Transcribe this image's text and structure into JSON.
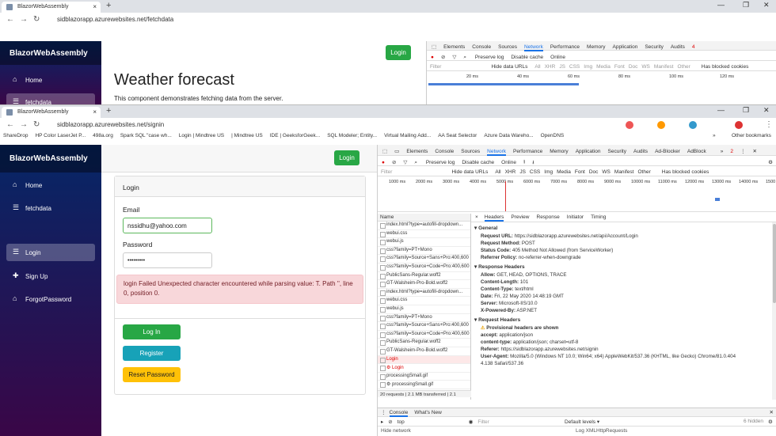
{
  "back": {
    "tab_title": "BlazorWebAssembly",
    "url": "sidblazorapp.azurewebsites.net/fetchdata",
    "brand": "BlazorWebAssembly",
    "nav": [
      "Home",
      "fetchdata"
    ],
    "login_label": "Login",
    "heading": "Weather forecast",
    "subtext": "This component demonstrates fetching data from the server.",
    "dev_tabs": [
      "Elements",
      "Console",
      "Sources",
      "Network",
      "Performance",
      "Memory",
      "Application",
      "Security",
      "Audits"
    ],
    "dev_active": "Network",
    "error_count": "4",
    "filter_placeholder": "Filter",
    "throttle": "Online",
    "preserve_log": "Preserve log",
    "disable_cache": "Disable cache",
    "hide_data_urls": "Hide data URLs",
    "types": [
      "All",
      "XHR",
      "JS",
      "CSS",
      "Img",
      "Media",
      "Font",
      "Doc",
      "WS",
      "Manifest",
      "Other"
    ],
    "blocked": "Has blocked cookies",
    "ticks": [
      "20 ms",
      "40 ms",
      "60 ms",
      "80 ms",
      "100 ms",
      "120 ms"
    ]
  },
  "front": {
    "tab_title": "BlazorWebAssembly",
    "url": "sidblazorapp.azurewebsites.net/signin",
    "bookmarks": [
      "ShareDrop",
      "HP Color LaserJet P...",
      "498a.org",
      "Spark SQL \"case wh...",
      "Login | Mindtree US",
      "| Mindtree US",
      "IDE | GeeksforGeek...",
      "SQL Modeler; Entity...",
      "Virtual Mailing Add...",
      "AA Seat Selector",
      "Azure Data Wareho...",
      "OpenDNS"
    ],
    "other_bookmarks": "Other bookmarks",
    "more_bookmarks": "»",
    "brand": "BlazorWebAssembly",
    "nav": [
      "Home",
      "fetchdata",
      "Login",
      "Sign Up",
      "ForgotPassword"
    ],
    "login_button": "Login",
    "card_title": "Login",
    "email_label": "Email",
    "email_value": "nssidhu@yahoo.com",
    "password_label": "Password",
    "password_value": "•••••••••",
    "alert": "login Failed Unexpected character encountered while parsing value: T. Path '', line 0, position 0.",
    "btn_login": "Log In",
    "btn_register": "Register",
    "btn_reset": "Reset Password",
    "dev_tabs": [
      "Elements",
      "Console",
      "Sources",
      "Network",
      "Performance",
      "Memory",
      "Application",
      "Security",
      "Audits",
      "Ad-Blocker",
      "AdBlock"
    ],
    "dev_active": "Network",
    "error_count": "2",
    "more_tabs": "»",
    "filter_placeholder": "Filter",
    "throttle": "Online",
    "preserve_log": "Preserve log",
    "disable_cache": "Disable cache",
    "hide_data_urls": "Hide data URLs",
    "types": [
      "All",
      "XHR",
      "JS",
      "CSS",
      "Img",
      "Media",
      "Font",
      "Doc",
      "WS",
      "Manifest",
      "Other"
    ],
    "blocked": "Has blocked cookies",
    "ticks": [
      "1000 ms",
      "2000 ms",
      "3000 ms",
      "4000 ms",
      "5000 ms",
      "6000 ms",
      "7000 ms",
      "8000 ms",
      "9000 ms",
      "10000 ms",
      "11000 ms",
      "12000 ms",
      "13000 ms",
      "14000 ms",
      "1500"
    ],
    "name_header": "Name",
    "requests": [
      "index.html?type=autofill-dropdown...",
      "webui.css",
      "webui.js",
      "css?family=PT+Mono",
      "css?family=Source+Sans+Pro:400,600",
      "css?family=Source+Code+Pro:400,600",
      "PublicSans-Regular.woff2",
      "GT-Walsheim-Pro-Bold.woff2",
      "index.html?type=autofill-dropdown...",
      "webui.css",
      "webui.js",
      "css?family=PT+Mono",
      "css?family=Source+Sans+Pro:400,600",
      "css?family=Source+Code+Pro:400,600",
      "PublicSans-Regular.woff2",
      "GT-Walsheim-Pro-Bold.woff2",
      "Login",
      "⚙ Login",
      "processingSmall.gif",
      "⚙ processingSmall.gif"
    ],
    "error_requests": [
      16,
      17
    ],
    "summary": "20 requests | 2.1 MB transferred | 2.1",
    "detail_tabs": [
      "Headers",
      "Preview",
      "Response",
      "Initiator",
      "Timing"
    ],
    "detail_active": "Headers",
    "close_glyph": "×",
    "general_title": "General",
    "general": [
      [
        "Request URL:",
        "https://sidblazorapp.azurewebsites.net/api/Account/Login"
      ],
      [
        "Request Method:",
        "POST"
      ],
      [
        "Status Code:",
        "405 Method Not Allowed (from ServiceWorker)"
      ],
      [
        "Referrer Policy:",
        "no-referrer-when-downgrade"
      ]
    ],
    "resp_title": "Response Headers",
    "resp": [
      [
        "Allow:",
        "GET, HEAD, OPTIONS, TRACE"
      ],
      [
        "Content-Length:",
        "101"
      ],
      [
        "Content-Type:",
        "text/html"
      ],
      [
        "Date:",
        "Fri, 22 May 2020 14:48:19 GMT"
      ],
      [
        "Server:",
        "Microsoft-IIS/10.0"
      ],
      [
        "X-Powered-By:",
        "ASP.NET"
      ]
    ],
    "reqh_title": "Request Headers",
    "prov": "Provisional headers are shown",
    "reqh": [
      [
        "accept:",
        "application/json"
      ],
      [
        "content-type:",
        "application/json; charset=utf-8"
      ],
      [
        "Referer:",
        "https://sidblazorapp.azurewebsites.net/signin"
      ],
      [
        "User-Agent:",
        "Mozilla/5.0 (Windows NT 10.0; Win64; x64) AppleWebKit/537.36 (KHTML, like Gecko) Chrome/81.0.404"
      ],
      [
        "",
        "4.138 Safari/537.36"
      ]
    ],
    "console_tabs": [
      "Console",
      "What's New"
    ],
    "console_context": "top",
    "console_filter": "Filter",
    "default_levels": "Default levels ▾",
    "hidden": "6 hidden",
    "hide_network": "Hide network",
    "log_xhr": "Log XMLHttpRequests"
  },
  "colors": {
    "accent_green": "#28a745",
    "info": "#17a2b8",
    "warning": "#ffc107",
    "alert_bg": "#f8d7da",
    "alert_text": "#721c24",
    "sidebar_top": "#052767",
    "sidebar_bottom": "#3a0647",
    "error_red": "#d93025"
  }
}
